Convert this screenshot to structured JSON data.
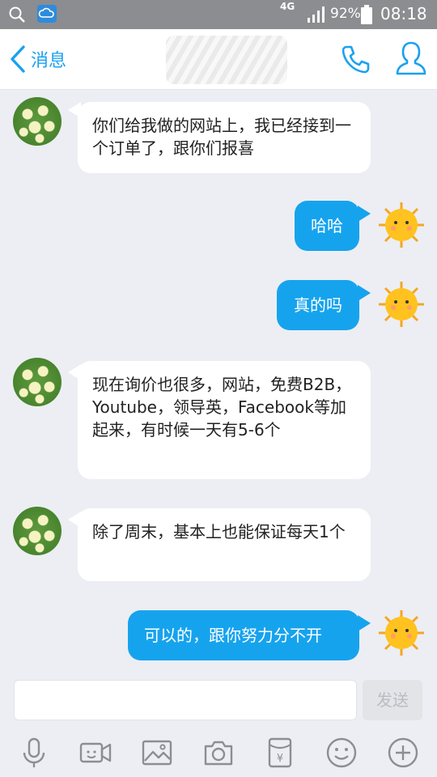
{
  "status_bar": {
    "network": "4G",
    "battery": "92%",
    "time": "08:18"
  },
  "header": {
    "back_label": "消息"
  },
  "messages": [
    {
      "side": "left",
      "text": "你们给我做的网站上，我已经接到一个订单了，跟你们报喜"
    },
    {
      "side": "right",
      "text": "哈哈"
    },
    {
      "side": "right",
      "text": "真的吗"
    },
    {
      "side": "left",
      "text": "现在询价也很多，网站，免费B2B，Youtube，领导英，Facebook等加起来，有时候一天有5-6个"
    },
    {
      "side": "left",
      "text": "除了周末，基本上也能保证每天1个"
    },
    {
      "side": "right",
      "text": "可以的，跟你努力分不开"
    }
  ],
  "input": {
    "value": "",
    "send_label": "发送"
  },
  "toolbar": [
    "microphone-icon",
    "video-icon",
    "image-icon",
    "camera-icon",
    "red-packet-icon",
    "emoji-icon",
    "plus-icon"
  ],
  "colors": {
    "accent": "#16a3ee",
    "background": "#eceef3"
  }
}
